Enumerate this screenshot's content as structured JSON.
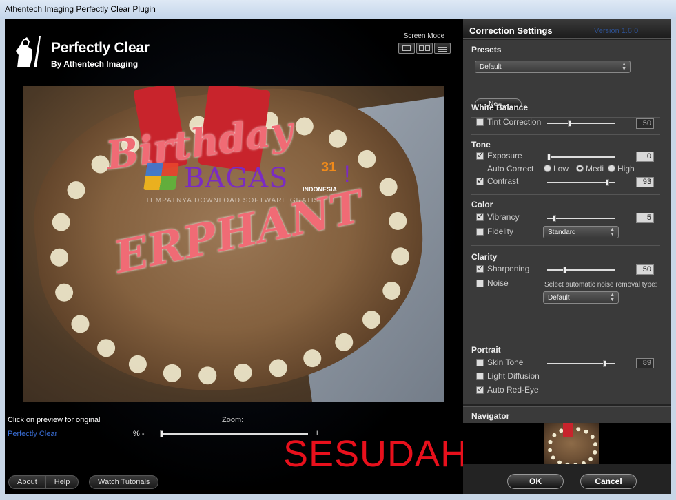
{
  "window": {
    "title": "Athentech Imaging Perfectly Clear Plugin"
  },
  "brand": {
    "name": "Perfectly Clear",
    "byline": "By Athentech Imaging"
  },
  "screen_mode": {
    "label": "Screen Mode"
  },
  "preview": {
    "watermark": {
      "word": "BAGAS",
      "number": "31",
      "country": "INDONESIA",
      "mark": "!",
      "tagline": "TEMPATNYA DOWNLOAD SOFTWARE GRATIS"
    },
    "click_hint": "Click on preview  for original",
    "link": "Perfectly Clear"
  },
  "zoom": {
    "label": "Zoom:",
    "minus": "% -",
    "plus": "+",
    "level": 0.0
  },
  "overlay_text": "SESUDAH",
  "bottom_buttons": {
    "about": "About",
    "help": "Help",
    "tutorials": "Watch Tutorials"
  },
  "panel": {
    "title": "Correction Settings",
    "version": "Version 1.6.0",
    "presets": {
      "title": "Presets",
      "selected": "Default",
      "new_button": "New..."
    },
    "white_balance": {
      "title": "White Balance",
      "tint": {
        "label": "Tint Correction",
        "checked": false,
        "value": "50"
      }
    },
    "tone": {
      "title": "Tone",
      "exposure": {
        "label": "Exposure",
        "checked": true,
        "value": "0"
      },
      "auto_correct": {
        "label": "Auto Correct",
        "options": [
          "Low",
          "Medi",
          "High"
        ],
        "selected": "Medi"
      },
      "contrast": {
        "label": "Contrast",
        "checked": true,
        "value": "93"
      }
    },
    "color": {
      "title": "Color",
      "vibrancy": {
        "label": "Vibrancy",
        "checked": true,
        "value": "5"
      },
      "fidelity": {
        "label": "Fidelity",
        "checked": false,
        "selected": "Standard"
      }
    },
    "clarity": {
      "title": "Clarity",
      "sharpening": {
        "label": "Sharpening",
        "checked": true,
        "value": "50"
      },
      "noise": {
        "label": "Noise",
        "checked": false,
        "note": "Select automatic noise removal type:",
        "selected": "Default"
      }
    },
    "portrait": {
      "title": "Portrait",
      "skin_tone": {
        "label": "Skin Tone",
        "checked": false,
        "value": "89"
      },
      "light_diffusion": {
        "label": "Light Diffusion",
        "checked": false
      },
      "red_eye": {
        "label": "Auto Red-Eye",
        "checked": true
      }
    },
    "navigator": {
      "title": "Navigator"
    },
    "ok": "OK",
    "cancel": "Cancel"
  }
}
